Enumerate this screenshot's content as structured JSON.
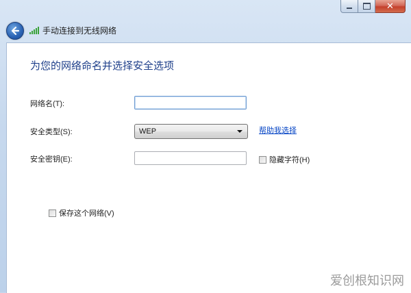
{
  "window": {
    "title": "手动连接到无线网络",
    "minimize_icon": "minimize-icon",
    "maximize_icon": "maximize-icon",
    "close_glyph": "✕"
  },
  "page": {
    "heading": "为您的网络命名并选择安全选项"
  },
  "form": {
    "network_name_label": "网络名(T):",
    "network_name_value": "",
    "security_type_label": "安全类型(S):",
    "security_type_value": "WEP",
    "help_link": "帮助我选择",
    "security_key_label": "安全密钥(E):",
    "security_key_value": "",
    "hide_chars_label": "隐藏字符(H)",
    "save_network_label": "保存这个网络(V)"
  },
  "watermark": "爱创根知识网",
  "colors": {
    "heading": "#1e3f8a",
    "link": "#0645c5",
    "frame": "#c7d9ee"
  }
}
